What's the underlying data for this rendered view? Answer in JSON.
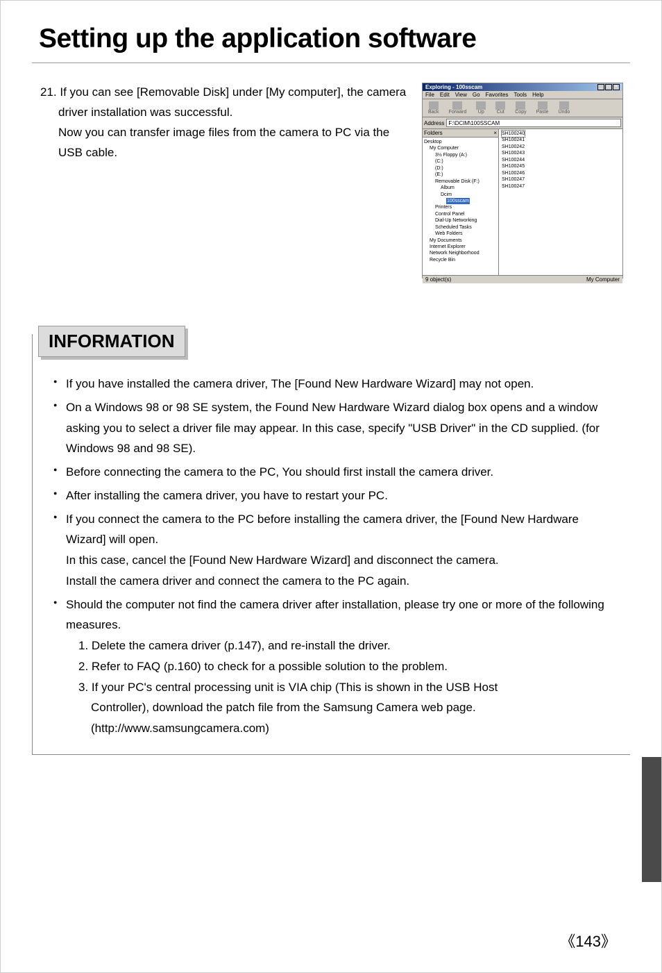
{
  "page_title": "Setting up the application software",
  "step_number": "21.",
  "step_text_line1": "If you can see [Removable Disk] under [My computer], the camera driver installation was successful.",
  "step_text_line2": "Now you can transfer image files from the camera to PC via the USB cable.",
  "screenshot": {
    "title": "Exploring - 100sscam",
    "menus": [
      "File",
      "Edit",
      "View",
      "Go",
      "Favorites",
      "Tools",
      "Help"
    ],
    "toolbar": [
      "Back",
      "Forward",
      "Up",
      "Cut",
      "Copy",
      "Paste",
      "Undo"
    ],
    "address_label": "Address",
    "address_value": "F:\\DCIM\\100SSCAM",
    "folders_label": "Folders",
    "folders_close": "×",
    "tree": {
      "desktop": "Desktop",
      "mycomputer": "My Computer",
      "floppy": "3½ Floppy (A:)",
      "c": "(C:)",
      "d": "(D:)",
      "e": "(E:)",
      "removable": "Removable Disk (F:)",
      "album": "Album",
      "dcim": "Dcim",
      "sscam": "100sscam",
      "printers": "Printers",
      "control": "Control Panel",
      "dialup": "Dial-Up Networking",
      "scheduled": "Scheduled Tasks",
      "webfolders": "Web Folders",
      "mydocs": "My Documents",
      "ie": "Internet Explorer",
      "network": "Network Neighborhood",
      "recycle": "Recycle Bin"
    },
    "files": [
      "SH100240",
      "SH100241",
      "SH100242",
      "SH100243",
      "SH100244",
      "SH100245",
      "SH100246",
      "SH100247",
      "SH100247"
    ],
    "status_left": "9 object(s)",
    "status_right": "My Computer"
  },
  "info_header": "INFORMATION",
  "bullets": {
    "b1": "If you have installed the camera driver, The [Found New Hardware Wizard] may not open.",
    "b2": "On a Windows 98 or 98 SE system, the Found New Hardware Wizard dialog box opens and a window asking you to select a driver file may appear. In this case, specify \"USB Driver\" in the CD supplied. (for Windows 98 and 98 SE).",
    "b3": "Before connecting the camera to the PC, You should first install the camera driver.",
    "b4": "After installing the camera driver, you have to restart your PC.",
    "b5": "If you connect the camera to the PC before installing the camera driver, the [Found New Hardware Wizard] will open.",
    "b5_sub1": "In this case, cancel the [Found New Hardware Wizard] and disconnect the camera.",
    "b5_sub2": "Install the camera driver and connect the camera to the PC again.",
    "b6": "Should the computer not find the camera driver after installation, please try one or more of the following measures.",
    "b6_1": "1. Delete the camera driver (p.147), and re-install the driver.",
    "b6_2": "2. Refer to FAQ (p.160) to check for a possible solution to the problem.",
    "b6_3a": "3. If your PC's central processing unit is VIA chip (This is shown in the USB Host",
    "b6_3b": "Controller), download the patch file from the Samsung Camera web page.",
    "b6_3c": "(http://www.samsungcamera.com)"
  },
  "page_number": "《143》"
}
